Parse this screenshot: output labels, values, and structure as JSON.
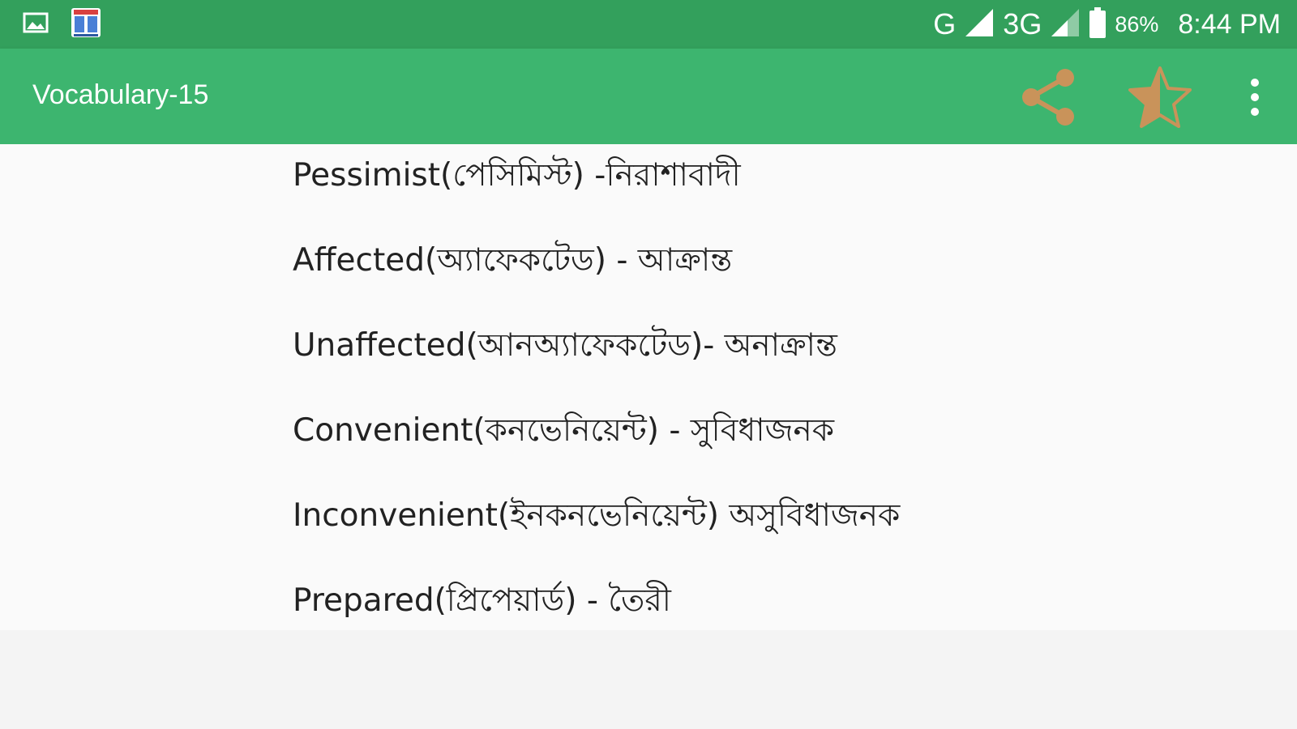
{
  "status_bar": {
    "left_icons": [
      "image-icon",
      "app-book-icon"
    ],
    "network_g_label": "G",
    "network_3g_label": "3G",
    "battery_percent": "86%",
    "time": "8:44 PM"
  },
  "app_bar": {
    "title": "Vocabulary-15",
    "actions": [
      "share-icon",
      "star-icon",
      "more-vert-icon"
    ]
  },
  "vocabulary": [
    "Pessimist(পেসিমিস্ট) -নিরাশাবাদী",
    "Affected(অ্যাফেকটেড) - আক্রান্ত",
    "Unaffected(আনঅ্যাফেকটেড)- অনাক্রান্ত",
    "Convenient(কনভেনিয়েন্ট) - সুবিধাজনক",
    "Inconvenient(ইনকনভেনিয়েন্ট) অসুবিধাজনক",
    "Prepared(প্রিপেয়ার্ড) - তৈরী"
  ],
  "colors": {
    "status_bar": "#33a05c",
    "app_bar": "#3db56f",
    "action_icon": "#c9935a",
    "text": "#222222",
    "background": "#fafafa"
  }
}
